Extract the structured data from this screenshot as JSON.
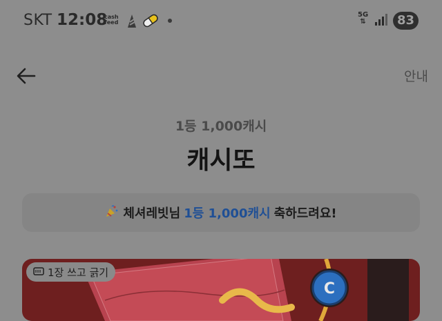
{
  "status_bar": {
    "carrier": "SKT",
    "time": "12:08",
    "cashfeed_label_line1": "cash",
    "cashfeed_label_line2": "feed",
    "network_label_line1": "5G",
    "network_label_line2": "⇅",
    "battery": "83"
  },
  "header": {
    "back_icon": "arrow-left-icon",
    "info_label": "안내"
  },
  "main": {
    "prize_subtitle": "1등 1,000캐시",
    "title": "캐시또",
    "banner": {
      "icon": "party-popper-icon",
      "text_before": "체셔레빗님",
      "highlight": "1등 1,000캐시",
      "text_after": "축하드려요!"
    },
    "card": {
      "chip_icon": "ticket-icon",
      "chip_label": "1장 쓰고 긁기",
      "coin_letter": "C"
    }
  },
  "colors": {
    "overlay_bg": "#8d8d8d",
    "banner_bg": "#858585",
    "highlight": "#1f4f95",
    "card_bg": "#6e1f1f",
    "coin": "#2c6fbf"
  }
}
